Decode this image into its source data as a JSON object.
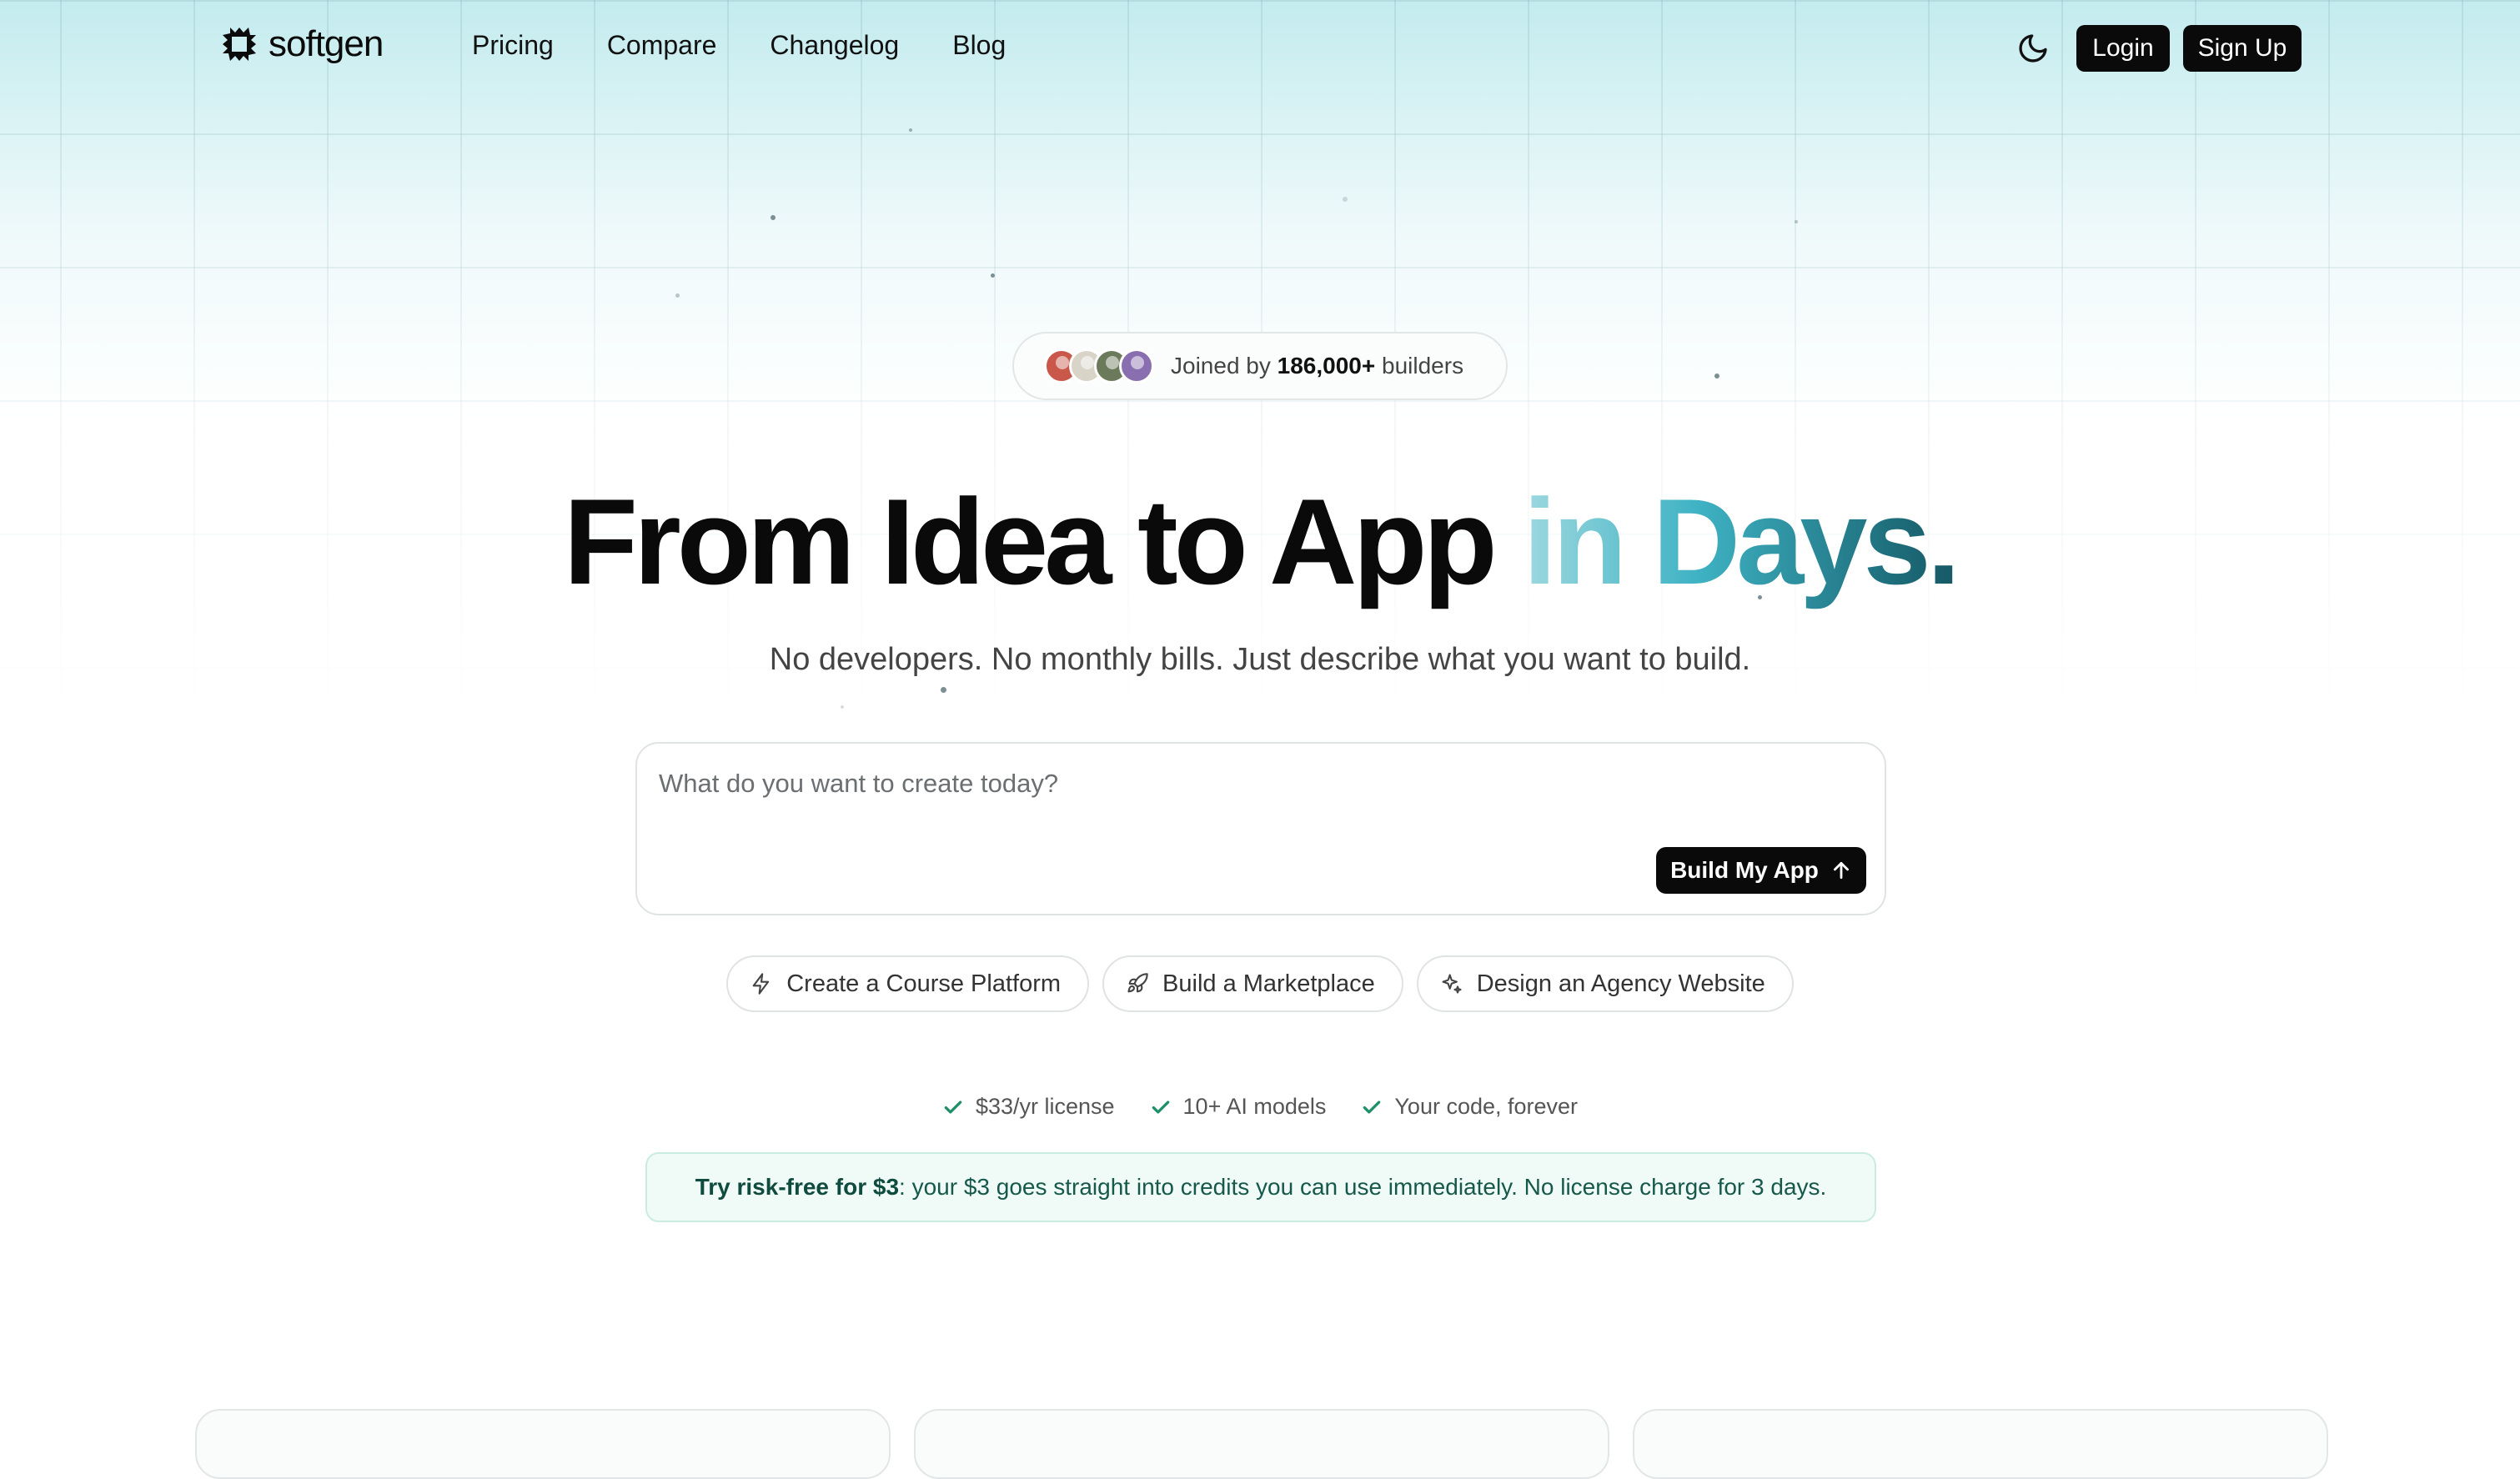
{
  "brand": {
    "name": "softgen"
  },
  "nav": {
    "links": [
      "Pricing",
      "Compare",
      "Changelog",
      "Blog"
    ],
    "login_label": "Login",
    "signup_label": "Sign Up",
    "theme_icon": "moon-icon"
  },
  "badge": {
    "prefix": "Joined by",
    "count": "186,000+",
    "suffix": "builders",
    "avatar_colors": [
      "#c9574a",
      "#d9d4c8",
      "#6b7a5a",
      "#8a6fb0"
    ]
  },
  "hero": {
    "title_main": "From Idea to App",
    "title_accent": "in Days.",
    "subtitle": "No developers. No monthly bills. Just describe what you want to build."
  },
  "prompt": {
    "placeholder": "What do you want to create today?",
    "value": "",
    "button_label": "Build My App",
    "button_icon": "arrow-up-icon"
  },
  "suggestions": [
    {
      "label": "Create a Course Platform",
      "icon": "lightning-icon"
    },
    {
      "label": "Build a Marketplace",
      "icon": "rocket-icon"
    },
    {
      "label": "Design an Agency Website",
      "icon": "sparkles-icon"
    }
  ],
  "features": [
    "$33/yr license",
    "10+ AI models",
    "Your code, forever"
  ],
  "risk_notice": {
    "bold": "Try risk-free for $3",
    "text": ": your $3 goes straight into credits you can use immediately. No license charge for 3 days."
  },
  "colors": {
    "accent_gradient_start": "#9ed8df",
    "accent_gradient_end": "#175866",
    "primary_button": "#0a0a0a",
    "check_green": "#1f8f6a"
  }
}
